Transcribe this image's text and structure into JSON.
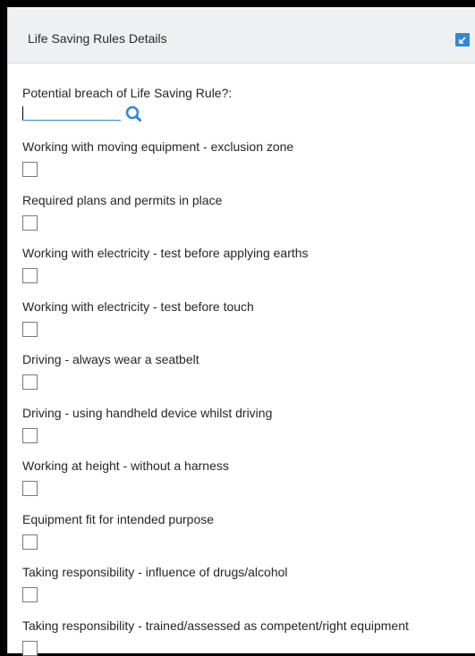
{
  "panel": {
    "title": "Life Saving Rules Details"
  },
  "lookup": {
    "label": "Potential breach of Life Saving Rule?:",
    "value": ""
  },
  "rules": [
    {
      "label": "Working with moving equipment - exclusion zone",
      "checked": false
    },
    {
      "label": "Required plans and permits in place",
      "checked": false
    },
    {
      "label": "Working with electricity - test before applying earths",
      "checked": false
    },
    {
      "label": "Working with electricity - test before touch",
      "checked": false
    },
    {
      "label": "Driving - always wear a seatbelt",
      "checked": false
    },
    {
      "label": "Driving - using handheld device whilst driving",
      "checked": false
    },
    {
      "label": "Working at height - without a harness",
      "checked": false
    },
    {
      "label": "Equipment fit for intended purpose",
      "checked": false
    },
    {
      "label": "Taking responsibility - influence of drugs/alcohol",
      "checked": false
    },
    {
      "label": "Taking responsibility - trained/assessed as competent/right equipment",
      "checked": false
    }
  ],
  "icons": {
    "collapse": "collapse-icon",
    "search": "search-icon"
  },
  "colors": {
    "accent": "#2f89d8",
    "header_bg": "#eef0f2"
  }
}
